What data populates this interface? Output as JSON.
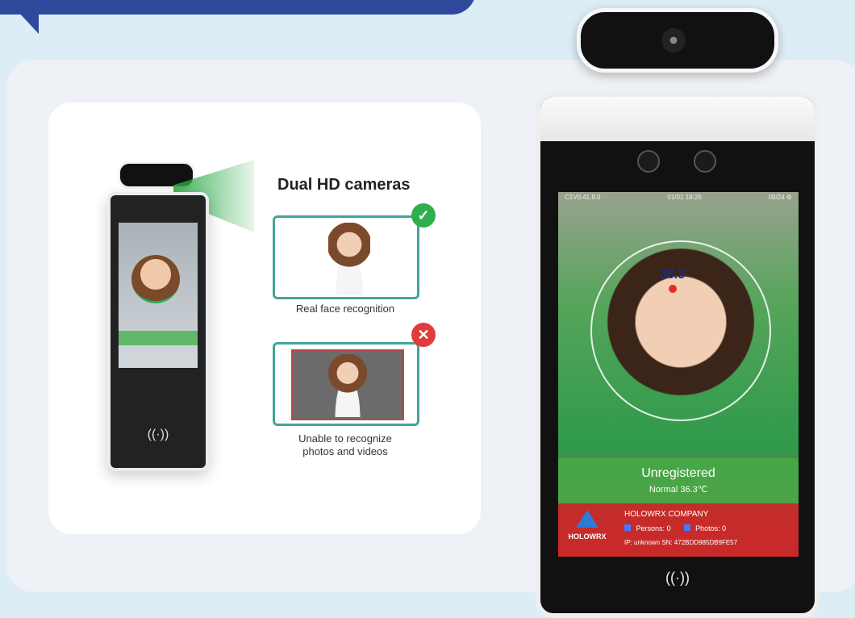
{
  "left_card": {
    "title": "Dual HD cameras",
    "real_caption": "Real face recognition",
    "fake_caption_line1": "Unable to recognize",
    "fake_caption_line2": "photos and videos",
    "ok_symbol": "✓",
    "reject_symbol": "✕"
  },
  "device": {
    "status_left": "C1V0.41.8.0",
    "status_mid": "01/01 18:25",
    "status_right": "09/24 ⚙",
    "temp_reading": "36.3",
    "status_title": "Unregistered",
    "status_detail": "Normal  36.3℃",
    "company": "HOLOWRX COMPANY",
    "persons_label": "Persons:",
    "persons_value": "0",
    "photos_label": "Photos:",
    "photos_value": "0",
    "ip_line": "IP: unknown  SN: 472BDD985DB9FE57",
    "logo_text": "HOLOWRX",
    "nfc_symbol": "((·))"
  },
  "colors": {
    "accent_blue": "#2f4a9c",
    "check_green": "#2fae4f",
    "reject_red": "#e23b3b",
    "teal_border": "#45a49a"
  }
}
